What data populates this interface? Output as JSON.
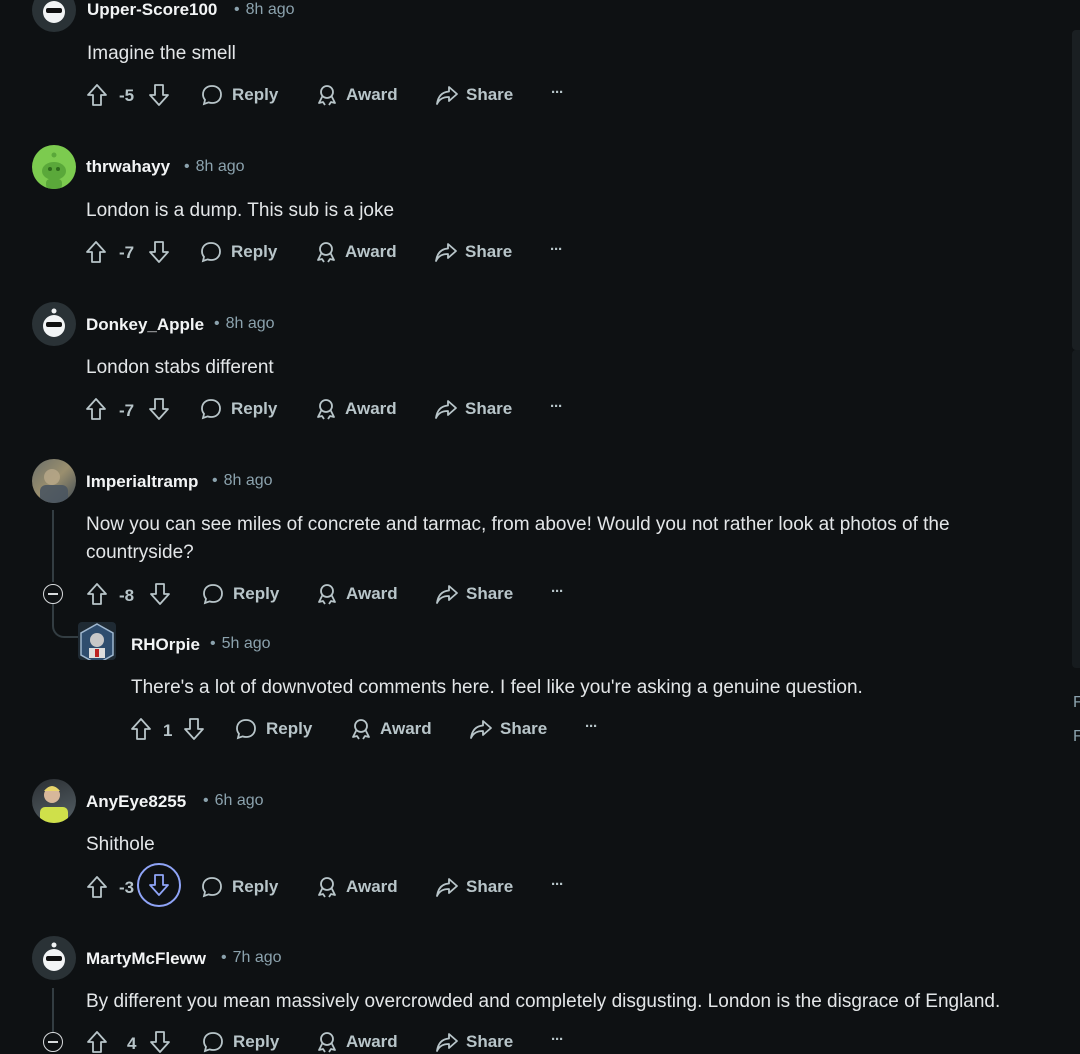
{
  "comments": [
    {
      "user": "Upper-Score100",
      "time": "8h ago",
      "text": "Imagine the smell",
      "score": "-5"
    },
    {
      "user": "thrwahayy",
      "time": "8h ago",
      "text": "London is a dump. This sub is a joke",
      "score": "-7"
    },
    {
      "user": "Donkey_Apple",
      "time": "8h ago",
      "text": "London stabs different",
      "score": "-7"
    },
    {
      "user": "Imperialtramp",
      "time": "8h ago",
      "text": "Now you can see miles of concrete and tarmac, from above! Would you not rather look at photos of the countryside?",
      "score": "-8"
    },
    {
      "user": "RHOrpie",
      "time": "5h ago",
      "text": "There's a lot of downvoted comments here. I feel like you're asking a genuine question.",
      "score": "1"
    },
    {
      "user": "AnyEye8255",
      "time": "6h ago",
      "text": "Shithole",
      "score": "-3"
    },
    {
      "user": "MartyMcFleww",
      "time": "7h ago",
      "text": "By different you mean massively overcrowded and completely disgusting. London is the disgrace of England.",
      "score": "4"
    }
  ],
  "actions": {
    "reply": "Reply",
    "award": "Award",
    "share": "Share",
    "more": "···"
  },
  "sidebar_letters": [
    "F",
    "F"
  ],
  "colors": {
    "background": "#0e1113",
    "downvote_focus": "#8fa4f7"
  }
}
